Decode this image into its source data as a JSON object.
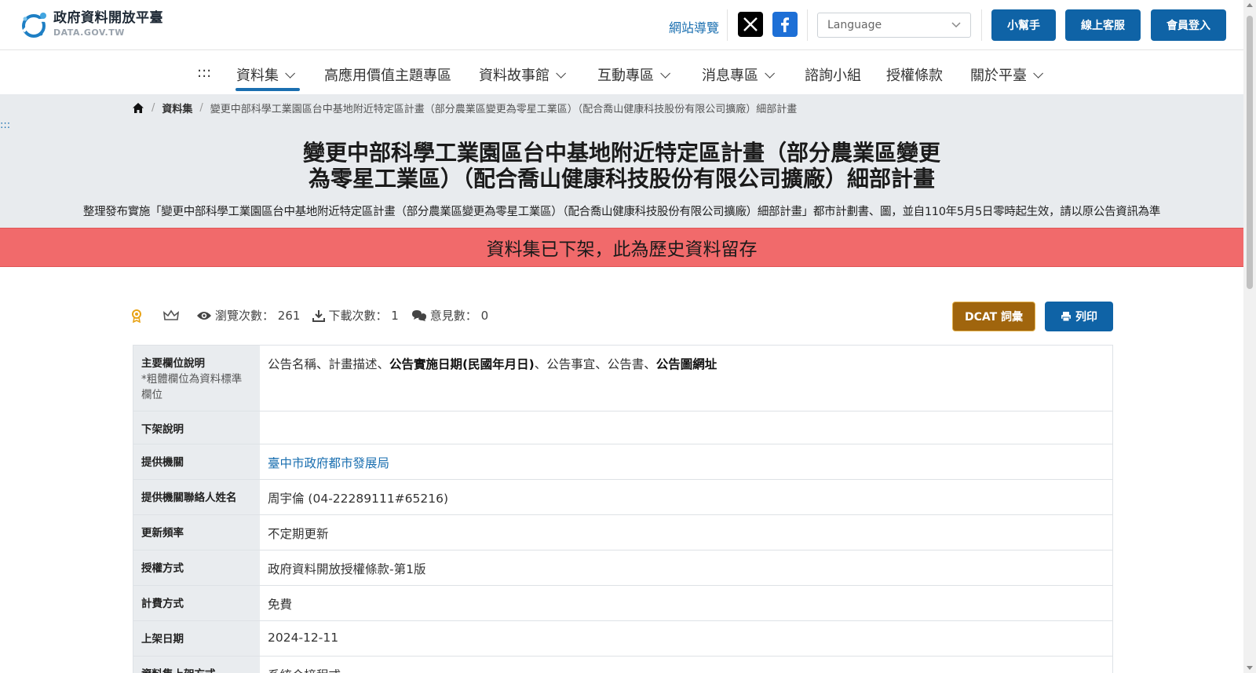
{
  "header": {
    "logo_title": "政府資料開放平臺",
    "logo_sub": "DATA.GOV.TW",
    "sitemap_label": "網站導覽",
    "language_placeholder": "Language",
    "helper_label": "小幫手",
    "support_label": "線上客服",
    "login_label": "會員登入"
  },
  "nav": {
    "accesskey": ":::",
    "items": [
      {
        "label": "資料集"
      },
      {
        "label": "高應用價值主題專區"
      },
      {
        "label": "資料故事館"
      },
      {
        "label": "互動專區"
      },
      {
        "label": "消息專區"
      },
      {
        "label": "諮詢小組"
      },
      {
        "label": "授權條款"
      },
      {
        "label": "關於平臺"
      }
    ]
  },
  "breadcrumb": {
    "datasets": "資料集",
    "current": "變更中部科學工業園區台中基地附近特定區計畫（部分農業區變更為零星工業區）（配合喬山健康科技股份有限公司擴廠）細部計畫"
  },
  "hero": {
    "accesskey": ":::",
    "title_line1": "變更中部科學工業園區台中基地附近特定區計畫（部分農業區變更",
    "title_line2": "為零星工業區）（配合喬山健康科技股份有限公司擴廠）細部計畫",
    "description": "整理發布實施「變更中部科學工業園區台中基地附近特定區計畫（部分農業區變更為零星工業區）（配合喬山健康科技股份有限公司擴廠）細部計畫」都市計劃書、圖，並自110年5月5日零時起生效，請以原公告資訊為準",
    "alert": "資料集已下架，此為歷史資料留存"
  },
  "stats": {
    "views_label": "瀏覽次數：",
    "views": "261",
    "downloads_label": "下載次數：",
    "downloads": "1",
    "comments_label": "意見數：",
    "comments": "0",
    "dcat_label": "DCAT 詞彙",
    "print_label": "列印"
  },
  "info": {
    "main_fields_label": "主要欄位說明",
    "main_fields_note": "*粗體欄位為資料標準欄位",
    "main_fields": {
      "p1": "公告名稱、計畫描述、",
      "b1": "公告實施日期(民國年月日)",
      "p2": "、公告事宜、公告書、",
      "b2": "公告圖網址"
    },
    "rows": [
      {
        "label": "下架說明",
        "value": ""
      },
      {
        "label": "提供機關",
        "value": "臺中市政府都市發展局"
      },
      {
        "label": "提供機關聯絡人姓名",
        "value": "周宇倫 (04-22289111#65216)"
      },
      {
        "label": "更新頻率",
        "value": "不定期更新"
      },
      {
        "label": "授權方式",
        "value": "政府資料開放授權條款-第1版"
      },
      {
        "label": "計費方式",
        "value": "免費"
      },
      {
        "label": "上架日期",
        "value": "2024-12-11"
      },
      {
        "label": "資料集上架方式",
        "value": "系統介接程式"
      }
    ]
  }
}
